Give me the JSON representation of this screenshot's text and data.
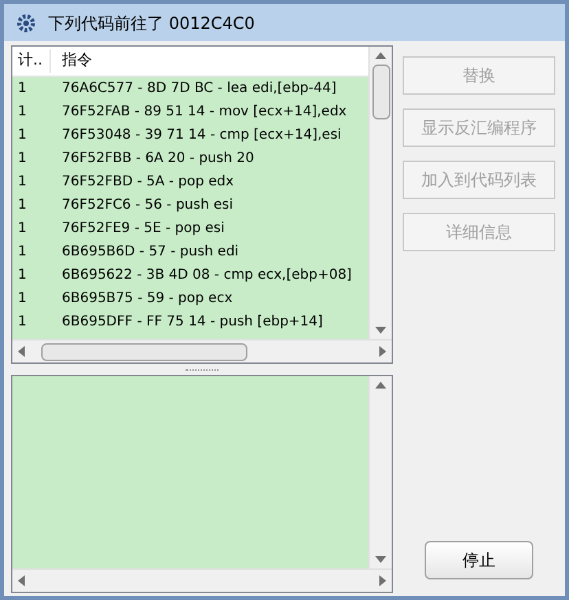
{
  "window": {
    "title": "下列代码前往了 0012C4C0"
  },
  "table": {
    "columns": [
      "计..",
      "指令"
    ],
    "rows": [
      {
        "count": "1",
        "instruction": "76A6C577 - 8D 7D BC  - lea edi,[ebp-44]"
      },
      {
        "count": "1",
        "instruction": "76F52FAB - 89 51 14  - mov [ecx+14],edx"
      },
      {
        "count": "1",
        "instruction": "76F53048 - 39 71 14  - cmp [ecx+14],esi"
      },
      {
        "count": "1",
        "instruction": "76F52FBB - 6A 20 - push 20"
      },
      {
        "count": "1",
        "instruction": "76F52FBD - 5A - pop edx"
      },
      {
        "count": "1",
        "instruction": "76F52FC6 - 56 - push esi"
      },
      {
        "count": "1",
        "instruction": "76F52FE9 - 5E - pop esi"
      },
      {
        "count": "1",
        "instruction": "6B695B6D - 57 - push edi"
      },
      {
        "count": "1",
        "instruction": "6B695622 - 3B 4D 08  - cmp ecx,[ebp+08]"
      },
      {
        "count": "1",
        "instruction": "6B695B75 - 59 - pop ecx"
      },
      {
        "count": "1",
        "instruction": "6B695DFF - FF 75 14  - push [ebp+14]"
      }
    ]
  },
  "buttons": [
    {
      "label": "替换",
      "disabled": true
    },
    {
      "label": "显示反汇编程序",
      "disabled": true
    },
    {
      "label": "加入到代码列表",
      "disabled": true
    },
    {
      "label": "详细信息",
      "disabled": true
    }
  ],
  "stop_button": {
    "label": "停止",
    "disabled": false
  }
}
